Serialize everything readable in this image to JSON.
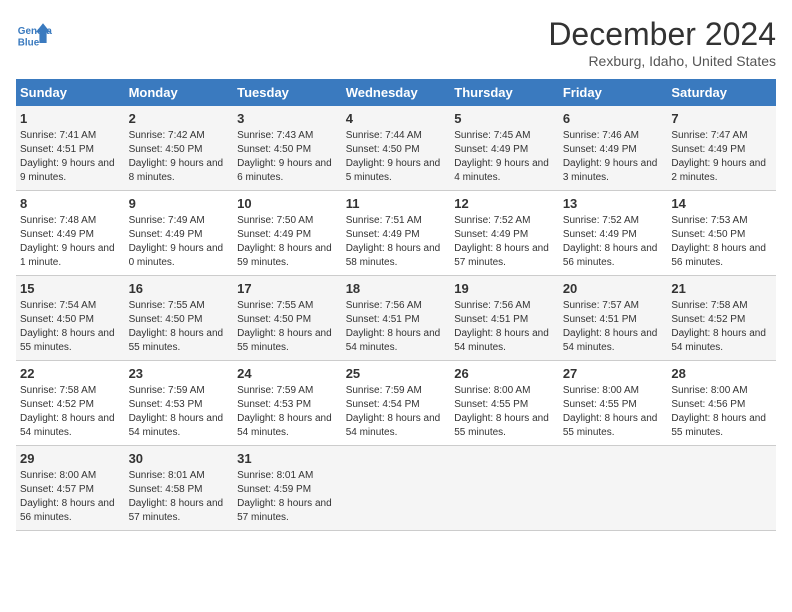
{
  "header": {
    "logo_line1": "General",
    "logo_line2": "Blue",
    "month_title": "December 2024",
    "location": "Rexburg, Idaho, United States"
  },
  "days_of_week": [
    "Sunday",
    "Monday",
    "Tuesday",
    "Wednesday",
    "Thursday",
    "Friday",
    "Saturday"
  ],
  "weeks": [
    [
      {
        "day": "1",
        "sunrise": "7:41 AM",
        "sunset": "4:51 PM",
        "daylight": "9 hours and 9 minutes."
      },
      {
        "day": "2",
        "sunrise": "7:42 AM",
        "sunset": "4:50 PM",
        "daylight": "9 hours and 8 minutes."
      },
      {
        "day": "3",
        "sunrise": "7:43 AM",
        "sunset": "4:50 PM",
        "daylight": "9 hours and 6 minutes."
      },
      {
        "day": "4",
        "sunrise": "7:44 AM",
        "sunset": "4:50 PM",
        "daylight": "9 hours and 5 minutes."
      },
      {
        "day": "5",
        "sunrise": "7:45 AM",
        "sunset": "4:49 PM",
        "daylight": "9 hours and 4 minutes."
      },
      {
        "day": "6",
        "sunrise": "7:46 AM",
        "sunset": "4:49 PM",
        "daylight": "9 hours and 3 minutes."
      },
      {
        "day": "7",
        "sunrise": "7:47 AM",
        "sunset": "4:49 PM",
        "daylight": "9 hours and 2 minutes."
      }
    ],
    [
      {
        "day": "8",
        "sunrise": "7:48 AM",
        "sunset": "4:49 PM",
        "daylight": "9 hours and 1 minute."
      },
      {
        "day": "9",
        "sunrise": "7:49 AM",
        "sunset": "4:49 PM",
        "daylight": "9 hours and 0 minutes."
      },
      {
        "day": "10",
        "sunrise": "7:50 AM",
        "sunset": "4:49 PM",
        "daylight": "8 hours and 59 minutes."
      },
      {
        "day": "11",
        "sunrise": "7:51 AM",
        "sunset": "4:49 PM",
        "daylight": "8 hours and 58 minutes."
      },
      {
        "day": "12",
        "sunrise": "7:52 AM",
        "sunset": "4:49 PM",
        "daylight": "8 hours and 57 minutes."
      },
      {
        "day": "13",
        "sunrise": "7:52 AM",
        "sunset": "4:49 PM",
        "daylight": "8 hours and 56 minutes."
      },
      {
        "day": "14",
        "sunrise": "7:53 AM",
        "sunset": "4:50 PM",
        "daylight": "8 hours and 56 minutes."
      }
    ],
    [
      {
        "day": "15",
        "sunrise": "7:54 AM",
        "sunset": "4:50 PM",
        "daylight": "8 hours and 55 minutes."
      },
      {
        "day": "16",
        "sunrise": "7:55 AM",
        "sunset": "4:50 PM",
        "daylight": "8 hours and 55 minutes."
      },
      {
        "day": "17",
        "sunrise": "7:55 AM",
        "sunset": "4:50 PM",
        "daylight": "8 hours and 55 minutes."
      },
      {
        "day": "18",
        "sunrise": "7:56 AM",
        "sunset": "4:51 PM",
        "daylight": "8 hours and 54 minutes."
      },
      {
        "day": "19",
        "sunrise": "7:56 AM",
        "sunset": "4:51 PM",
        "daylight": "8 hours and 54 minutes."
      },
      {
        "day": "20",
        "sunrise": "7:57 AM",
        "sunset": "4:51 PM",
        "daylight": "8 hours and 54 minutes."
      },
      {
        "day": "21",
        "sunrise": "7:58 AM",
        "sunset": "4:52 PM",
        "daylight": "8 hours and 54 minutes."
      }
    ],
    [
      {
        "day": "22",
        "sunrise": "7:58 AM",
        "sunset": "4:52 PM",
        "daylight": "8 hours and 54 minutes."
      },
      {
        "day": "23",
        "sunrise": "7:59 AM",
        "sunset": "4:53 PM",
        "daylight": "8 hours and 54 minutes."
      },
      {
        "day": "24",
        "sunrise": "7:59 AM",
        "sunset": "4:53 PM",
        "daylight": "8 hours and 54 minutes."
      },
      {
        "day": "25",
        "sunrise": "7:59 AM",
        "sunset": "4:54 PM",
        "daylight": "8 hours and 54 minutes."
      },
      {
        "day": "26",
        "sunrise": "8:00 AM",
        "sunset": "4:55 PM",
        "daylight": "8 hours and 55 minutes."
      },
      {
        "day": "27",
        "sunrise": "8:00 AM",
        "sunset": "4:55 PM",
        "daylight": "8 hours and 55 minutes."
      },
      {
        "day": "28",
        "sunrise": "8:00 AM",
        "sunset": "4:56 PM",
        "daylight": "8 hours and 55 minutes."
      }
    ],
    [
      {
        "day": "29",
        "sunrise": "8:00 AM",
        "sunset": "4:57 PM",
        "daylight": "8 hours and 56 minutes."
      },
      {
        "day": "30",
        "sunrise": "8:01 AM",
        "sunset": "4:58 PM",
        "daylight": "8 hours and 57 minutes."
      },
      {
        "day": "31",
        "sunrise": "8:01 AM",
        "sunset": "4:59 PM",
        "daylight": "8 hours and 57 minutes."
      },
      null,
      null,
      null,
      null
    ]
  ]
}
